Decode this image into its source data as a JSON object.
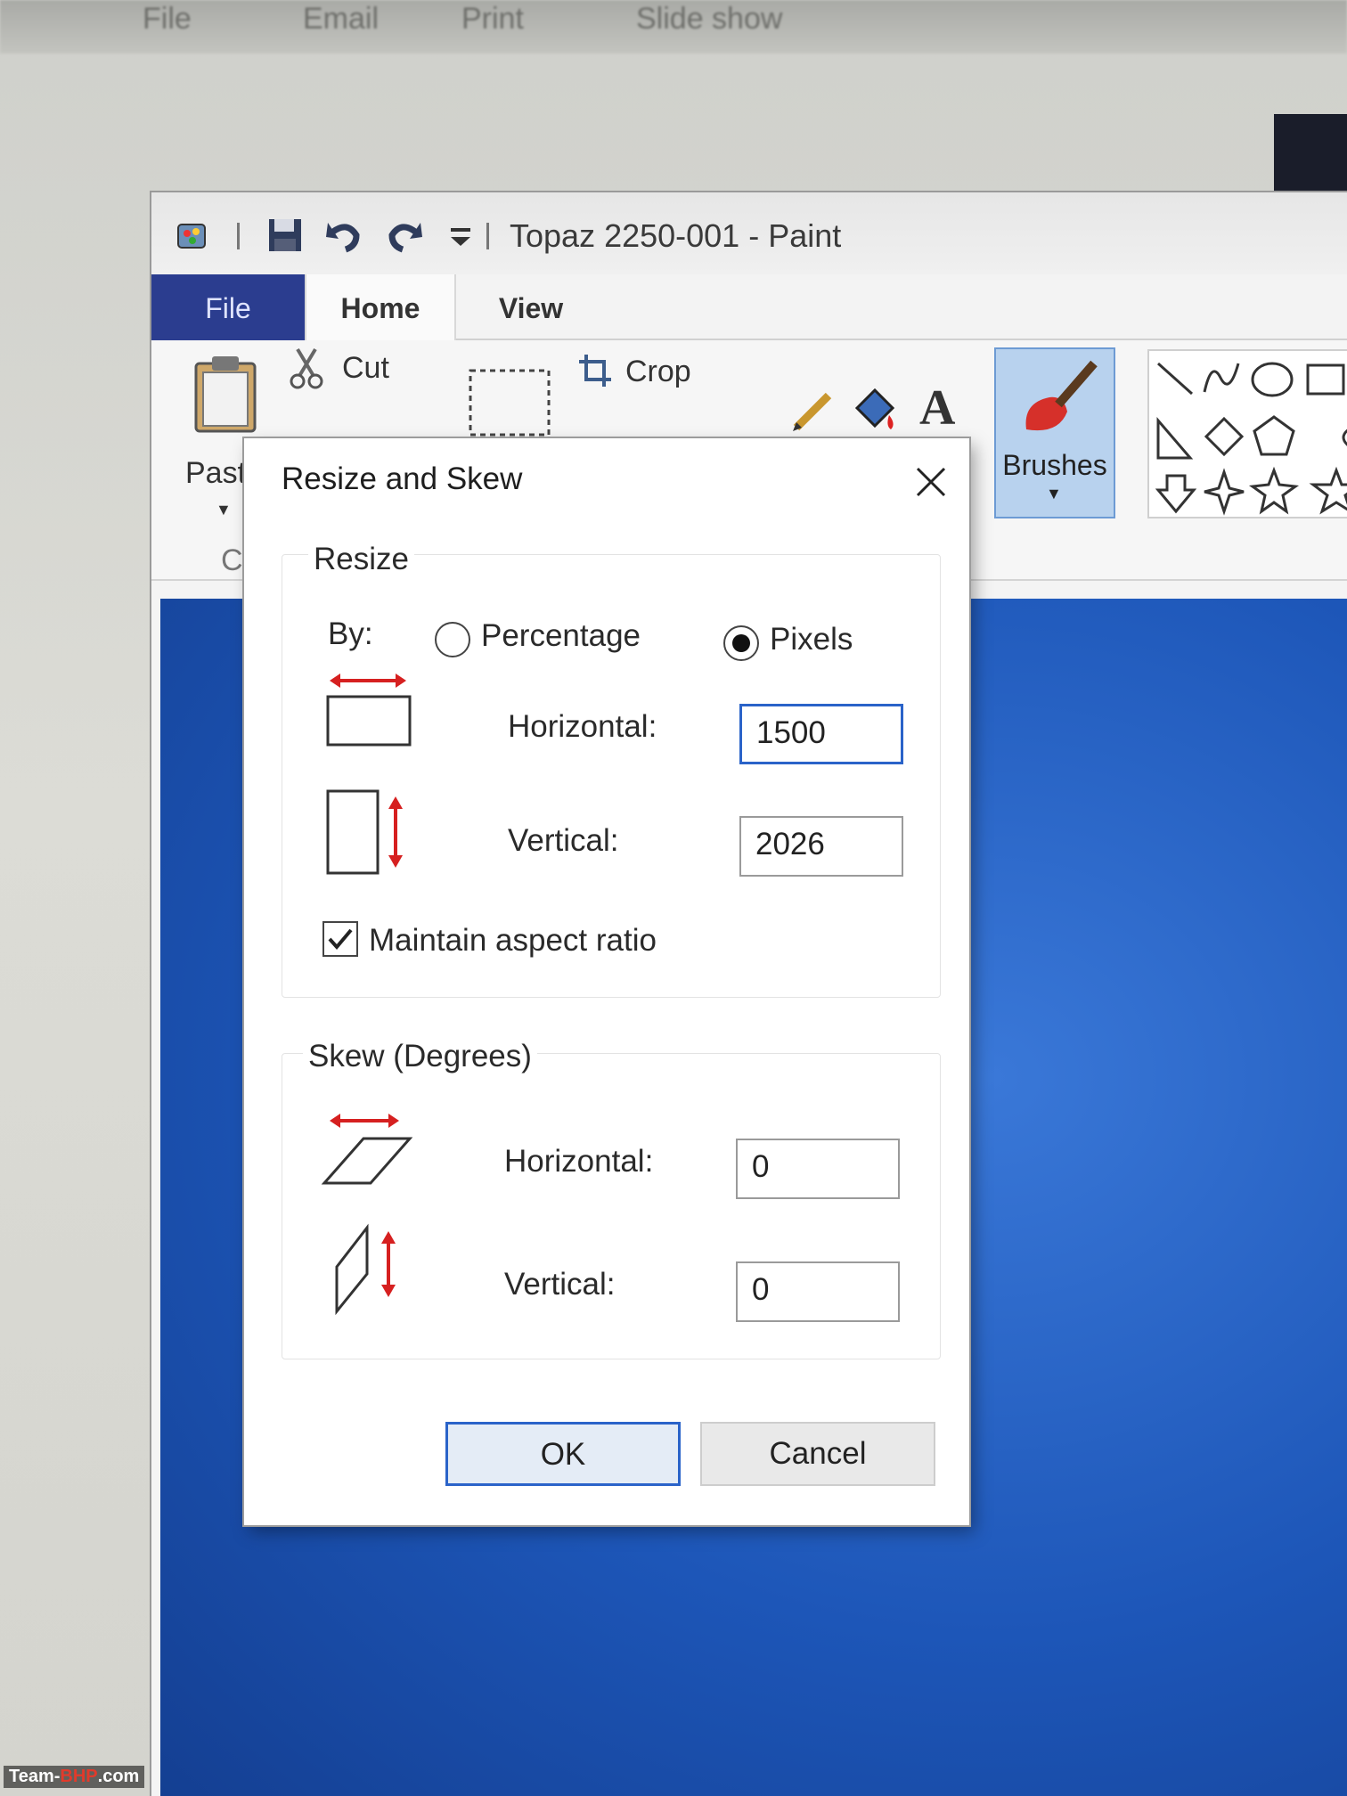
{
  "background_app": {
    "menu": [
      "File",
      "Email",
      "Print",
      "Slide show"
    ]
  },
  "window": {
    "title": "Topaz 2250-001 - Paint"
  },
  "ribbon": {
    "tabs": [
      "File",
      "Home",
      "View"
    ],
    "paste_label": "Paste",
    "cut_label": "Cut",
    "crop_label": "Crop",
    "brushes_label": "Brushes",
    "clipboard_group_partial": "Cl"
  },
  "dialog": {
    "title": "Resize and Skew",
    "resize": {
      "group_title": "Resize",
      "by_label": "By:",
      "options": [
        "Percentage",
        "Pixels"
      ],
      "selected_option": "Pixels",
      "horizontal_label": "Horizontal:",
      "horizontal_value": "1500",
      "vertical_label": "Vertical:",
      "vertical_value": "2026",
      "aspect_label": "Maintain aspect ratio",
      "aspect_checked": true
    },
    "skew": {
      "group_title": "Skew (Degrees)",
      "horizontal_label": "Horizontal:",
      "horizontal_value": "0",
      "vertical_label": "Vertical:",
      "vertical_value": "0"
    },
    "ok_label": "OK",
    "cancel_label": "Cancel"
  },
  "watermark": {
    "prefix": "Team-",
    "brand": "BHP",
    "suffix": ".com"
  },
  "colors": {
    "file_tab": "#2b3d8f",
    "canvas_blue": "#1d56b8",
    "focus_border": "#2a63c9",
    "arrow_red": "#d62020"
  },
  "icons": [
    "paint-app-icon",
    "save-icon",
    "undo-icon",
    "redo-icon",
    "customize-dropdown-icon",
    "clipboard-icon",
    "scissors-icon",
    "select-icon",
    "crop-icon",
    "pencil-icon",
    "fill-icon",
    "text-icon",
    "brush-icon",
    "close-icon"
  ]
}
